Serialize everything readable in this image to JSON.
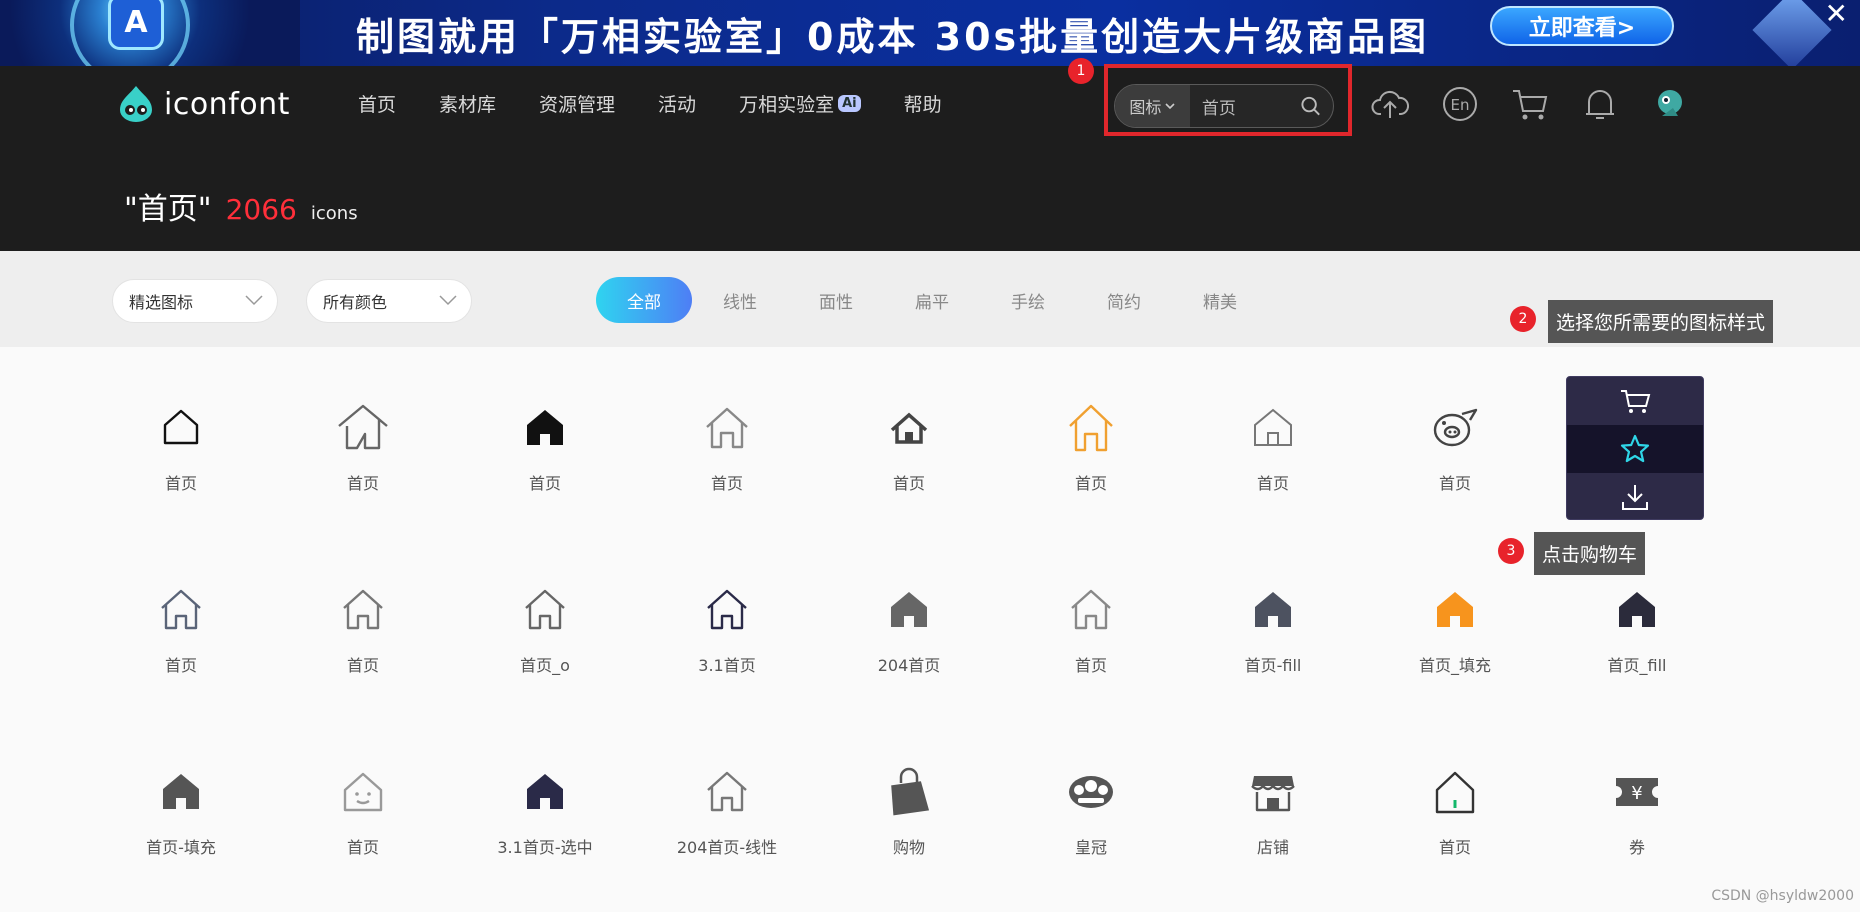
{
  "banner": {
    "text": "制图就用「万相实验室」0成本 30s批量创造大片级商品图",
    "cta": "立即查看>",
    "logo_letter": "A",
    "close": "✕"
  },
  "header": {
    "logo_text": "iconfont",
    "nav": [
      {
        "label": "首页"
      },
      {
        "label": "素材库"
      },
      {
        "label": "资源管理"
      },
      {
        "label": "活动"
      },
      {
        "label": "万相实验室",
        "badge": "Ai"
      },
      {
        "label": "帮助"
      }
    ],
    "search": {
      "type_label": "图标",
      "value": "首页"
    },
    "lang_label": "En"
  },
  "result": {
    "query": "\"首页\"",
    "count": "2066",
    "unit": "icons"
  },
  "filters": {
    "select_1": "精选图标",
    "select_2": "所有颜色",
    "tabs": [
      "全部",
      "线性",
      "面性",
      "扁平",
      "手绘",
      "简约",
      "精美"
    ],
    "active_tab": "全部"
  },
  "annotations": {
    "a1": "1",
    "a2": "2",
    "a2_text": "选择您所需要的图标样式",
    "a3": "3",
    "a3_text": "点击购物车"
  },
  "icons": {
    "row1": [
      {
        "label": "首页",
        "icon": "house-outline-icon",
        "color": "#111111"
      },
      {
        "label": "首页",
        "icon": "house-open-icon",
        "color": "#666666"
      },
      {
        "label": "首页",
        "icon": "house-solid-icon",
        "color": "#111111"
      },
      {
        "label": "首页",
        "icon": "house-line-icon",
        "color": "#888888"
      },
      {
        "label": "首页",
        "icon": "house-small-icon",
        "color": "#444444"
      },
      {
        "label": "首页",
        "icon": "house-orange-icon",
        "color": "#f0a030"
      },
      {
        "label": "首页",
        "icon": "house-thin-icon",
        "color": "#777777"
      },
      {
        "label": "首页",
        "icon": "pig-icon",
        "color": "#444444"
      }
    ],
    "row2": [
      {
        "label": "首页",
        "icon": "house-icon",
        "color": "#5a6478"
      },
      {
        "label": "首页",
        "icon": "house-icon",
        "color": "#777777"
      },
      {
        "label": "首页_o",
        "icon": "house-icon",
        "color": "#666666"
      },
      {
        "label": "3.1首页",
        "icon": "house-icon",
        "color": "#2a2a48"
      },
      {
        "label": "204首页",
        "icon": "house-solid-icon",
        "color": "#666666"
      },
      {
        "label": "首页",
        "icon": "house-icon",
        "color": "#888888"
      },
      {
        "label": "首页-fill",
        "icon": "house-solid-icon",
        "color": "#4d5260"
      },
      {
        "label": "首页_填充",
        "icon": "house-solid-icon",
        "color": "#f7941d"
      },
      {
        "label": "首页_fill",
        "icon": "house-solid-icon",
        "color": "#2b2b3b"
      }
    ],
    "row3": [
      {
        "label": "首页-填充",
        "icon": "house-solid-icon",
        "color": "#555555"
      },
      {
        "label": "首页",
        "icon": "house-face-icon",
        "color": "#999999"
      },
      {
        "label": "3.1首页-选中",
        "icon": "house-solid-icon",
        "color": "#2a2a48"
      },
      {
        "label": "204首页-线性",
        "icon": "house-icon",
        "color": "#777777"
      },
      {
        "label": "购物",
        "icon": "shopping-bag-icon",
        "color": "#555555"
      },
      {
        "label": "皇冠",
        "icon": "crown-icon",
        "color": "#555555"
      },
      {
        "label": "店铺",
        "icon": "store-icon",
        "color": "#555555"
      },
      {
        "label": "首页",
        "icon": "house-green-icon",
        "color": "#333333"
      },
      {
        "label": "券",
        "icon": "coupon-icon",
        "color": "#555555"
      }
    ]
  },
  "watermark": "CSDN @hsyldw2000"
}
